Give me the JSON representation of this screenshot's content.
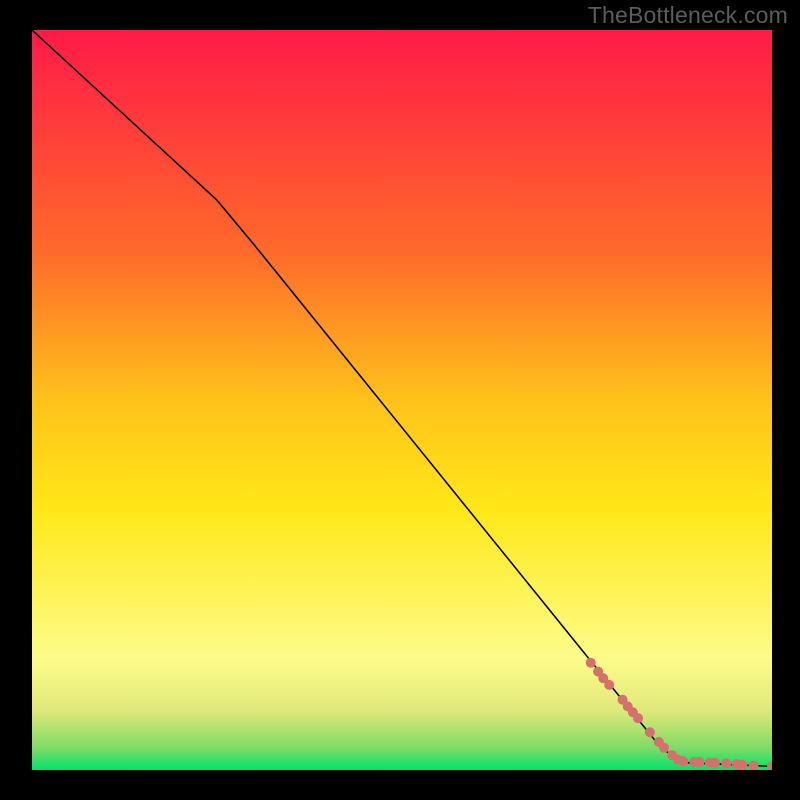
{
  "watermark": "TheBottleneck.com",
  "chart_data": {
    "type": "line",
    "title": "",
    "xlabel": "",
    "ylabel": "",
    "xlim": [
      0,
      100
    ],
    "ylim": [
      0,
      100
    ],
    "background_gradient": {
      "stops": [
        {
          "y": 100,
          "color": "#ff1a47"
        },
        {
          "y": 70,
          "color": "#ff6a2a"
        },
        {
          "y": 50,
          "color": "#ffc21a"
        },
        {
          "y": 35,
          "color": "#ffe81a"
        },
        {
          "y": 15,
          "color": "#fdfc8a"
        },
        {
          "y": 8,
          "color": "#dfe87a"
        },
        {
          "y": 3,
          "color": "#7edc66"
        },
        {
          "y": 0,
          "color": "#00e36b"
        }
      ]
    },
    "series": [
      {
        "name": "curve",
        "type": "line",
        "color": "#000000",
        "width": 1.6,
        "points": [
          {
            "x": 0,
            "y": 100
          },
          {
            "x": 25,
            "y": 77
          },
          {
            "x": 30,
            "y": 71
          },
          {
            "x": 85,
            "y": 3
          },
          {
            "x": 88,
            "y": 1
          },
          {
            "x": 100,
            "y": 0.5
          }
        ]
      },
      {
        "name": "markers",
        "type": "scatter",
        "color": "#d6706c",
        "radius": 5,
        "points": [
          {
            "x": 75.5,
            "y": 14.5
          },
          {
            "x": 76.5,
            "y": 13.3
          },
          {
            "x": 77.2,
            "y": 12.4
          },
          {
            "x": 78.0,
            "y": 11.5
          },
          {
            "x": 79.8,
            "y": 9.5
          },
          {
            "x": 80.5,
            "y": 8.6
          },
          {
            "x": 81.2,
            "y": 7.8
          },
          {
            "x": 81.9,
            "y": 7.0
          },
          {
            "x": 83.5,
            "y": 5.1
          },
          {
            "x": 84.7,
            "y": 3.8
          },
          {
            "x": 85.4,
            "y": 3.0
          },
          {
            "x": 86.5,
            "y": 2.0
          },
          {
            "x": 87.3,
            "y": 1.4
          },
          {
            "x": 88.0,
            "y": 1.2
          },
          {
            "x": 89.5,
            "y": 1.1
          },
          {
            "x": 90.2,
            "y": 1.1
          },
          {
            "x": 91.6,
            "y": 1.0
          },
          {
            "x": 92.3,
            "y": 1.0
          },
          {
            "x": 93.8,
            "y": 0.9
          },
          {
            "x": 95.2,
            "y": 0.8
          },
          {
            "x": 96.0,
            "y": 0.7
          },
          {
            "x": 97.5,
            "y": 0.6
          },
          {
            "x": 100.0,
            "y": 0.5
          }
        ]
      }
    ]
  }
}
